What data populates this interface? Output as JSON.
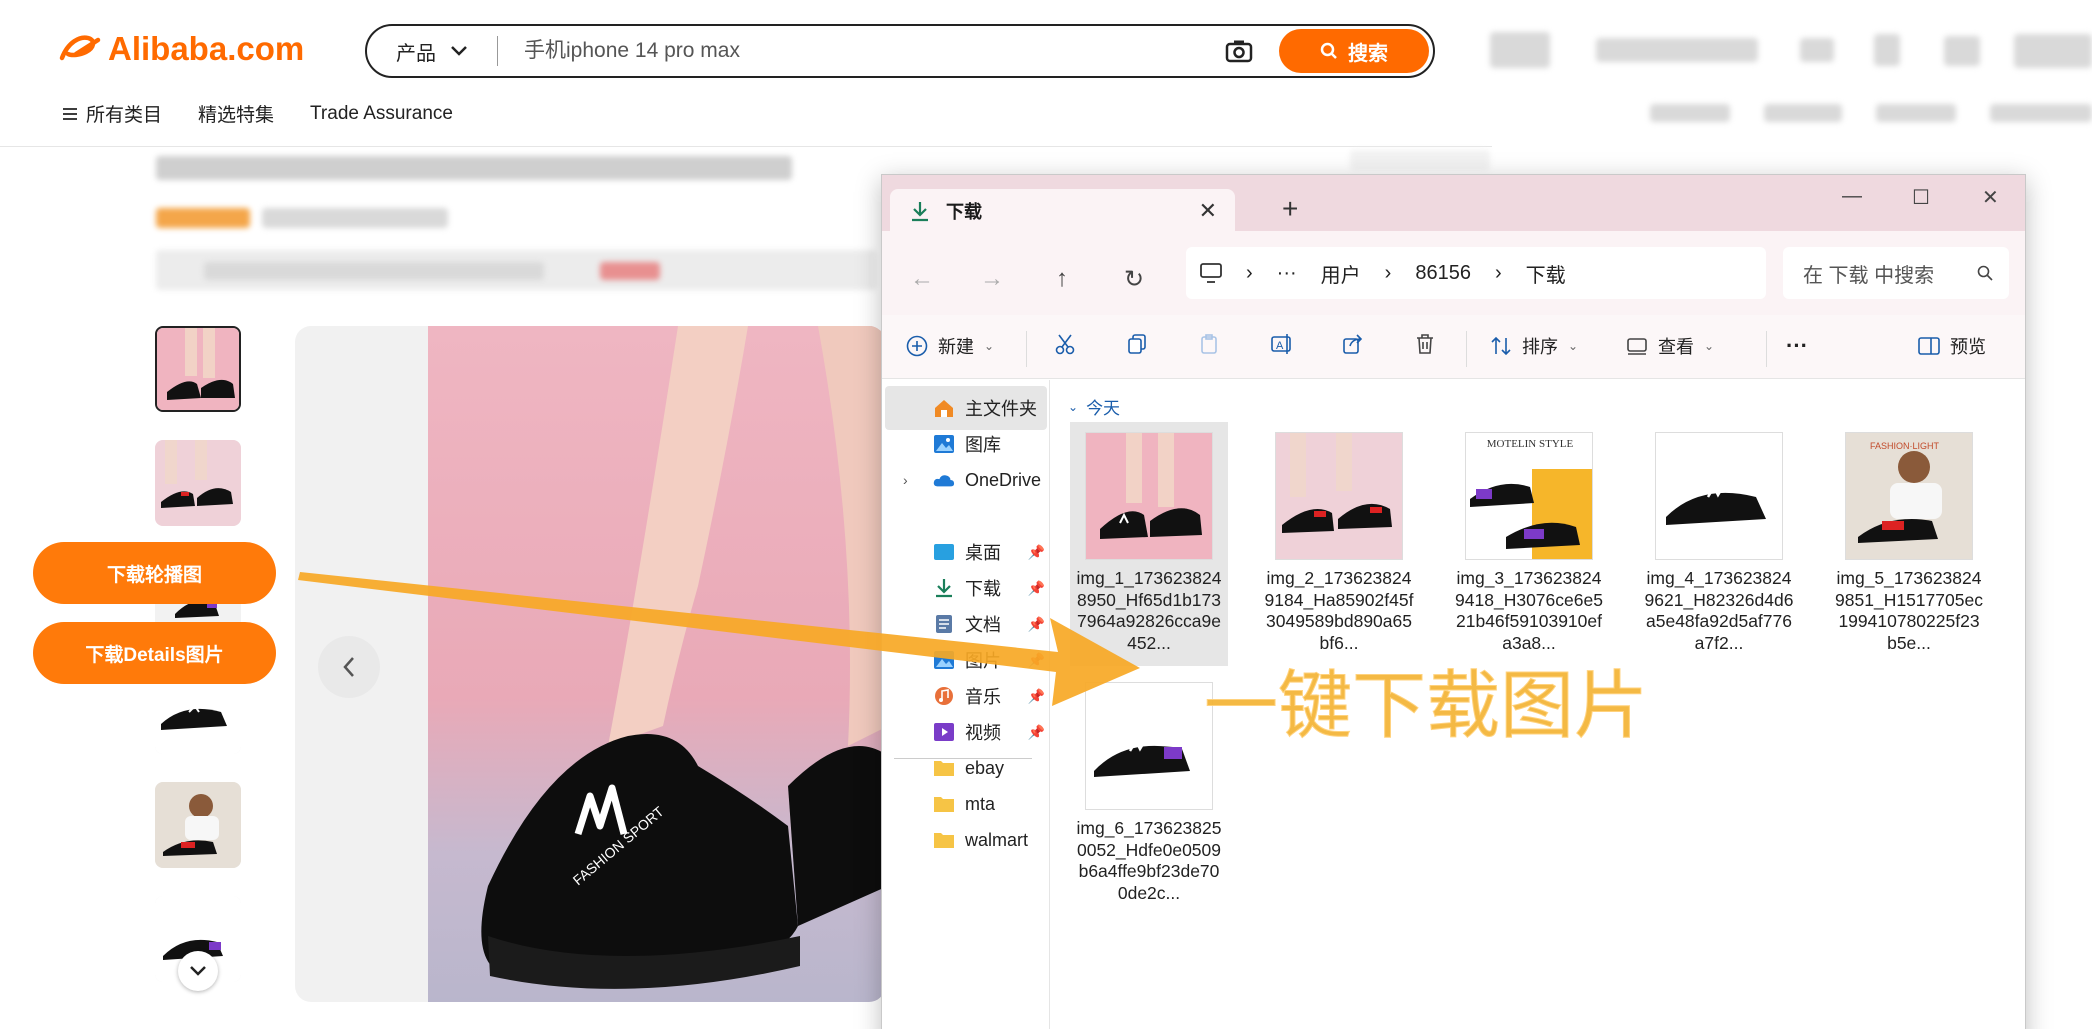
{
  "site": {
    "logo_text": "Alibaba.com",
    "search": {
      "category_label": "产品",
      "placeholder": "手机iphone 14 pro max",
      "button_label": "搜索"
    },
    "subnav": {
      "all_categories": "所有类目",
      "featured": "精选特集",
      "trade_assurance": "Trade Assurance"
    },
    "accent_color": "#ff6a00"
  },
  "extension_buttons": {
    "download_carousel": "下载轮播图",
    "download_details": "下载Details图片"
  },
  "explorer": {
    "tab_title": "下载",
    "breadcrumb": [
      "用户",
      "86156",
      "下载"
    ],
    "search_placeholder": "在 下载 中搜索",
    "toolbar": {
      "new": "新建",
      "sort": "排序",
      "view": "查看",
      "preview": "预览"
    },
    "nav_items": [
      {
        "label": "主文件夹",
        "icon": "home-icon"
      },
      {
        "label": "图库",
        "icon": "gallery-icon"
      },
      {
        "label": "OneDrive",
        "icon": "cloud-icon"
      },
      {
        "label": "桌面",
        "icon": "desktop-icon"
      },
      {
        "label": "下载",
        "icon": "download-icon"
      },
      {
        "label": "文档",
        "icon": "document-icon"
      },
      {
        "label": "图片",
        "icon": "pictures-icon"
      },
      {
        "label": "音乐",
        "icon": "music-icon"
      },
      {
        "label": "视频",
        "icon": "video-icon"
      },
      {
        "label": "ebay",
        "icon": "folder-icon"
      },
      {
        "label": "mta",
        "icon": "folder-icon"
      },
      {
        "label": "walmart",
        "icon": "folder-icon"
      }
    ],
    "group_label": "今天",
    "files": [
      {
        "name": "img_1_1736238248950_Hf65d1b1737964a92826cca9e452..."
      },
      {
        "name": "img_2_1736238249184_Ha85902f45f3049589bd890a65bf6..."
      },
      {
        "name": "img_3_1736238249418_H3076ce6e521b46f59103910efa3a8..."
      },
      {
        "name": "img_4_1736238249621_H82326d4d6a5e48fa92d5af776a7f2..."
      },
      {
        "name": "img_5_1736238249851_H1517705ec199410780225f23b5e..."
      },
      {
        "name": "img_6_1736238250052_Hdfe0e0509b6a4ffe9bf23de700de2c..."
      }
    ],
    "thumb3_caption": "MOTELIN STYLE",
    "thumb5_caption": "FASHION·LIGHT"
  },
  "overlay_text": "一键下载图片",
  "product_photo_text": "FASHION SPORT"
}
